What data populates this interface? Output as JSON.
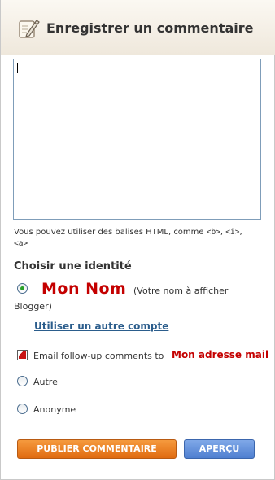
{
  "header": {
    "title": "Enregistrer un commentaire",
    "icon": "pen-icon"
  },
  "comment": {
    "value": ""
  },
  "html_note": {
    "prefix": "Vous pouvez utiliser des balises HTML, comme ",
    "tag_b": "<b>",
    "sep1": ", ",
    "tag_i": "<i>",
    "sep2": ",",
    "tag_a": "<a>"
  },
  "identity": {
    "title": "Choisir une identité",
    "name_value": "Mon Nom",
    "name_hint": "(Votre nom à afficher",
    "blogger": "Blogger)",
    "other_account": "Utiliser un autre compte",
    "follow_label": "Email follow-up comments to",
    "email_value": "Mon adresse mail",
    "other_label": "Autre",
    "anonymous_label": "Anonyme",
    "selected": "blogger"
  },
  "buttons": {
    "publish": "PUBLIER COMMENTAIRE",
    "preview": "APERÇU"
  },
  "colors": {
    "accent_orange": "#e06b10",
    "accent_blue": "#4f7fd0",
    "handwritten_red": "#c40000",
    "link_blue": "#2b5d8c"
  }
}
